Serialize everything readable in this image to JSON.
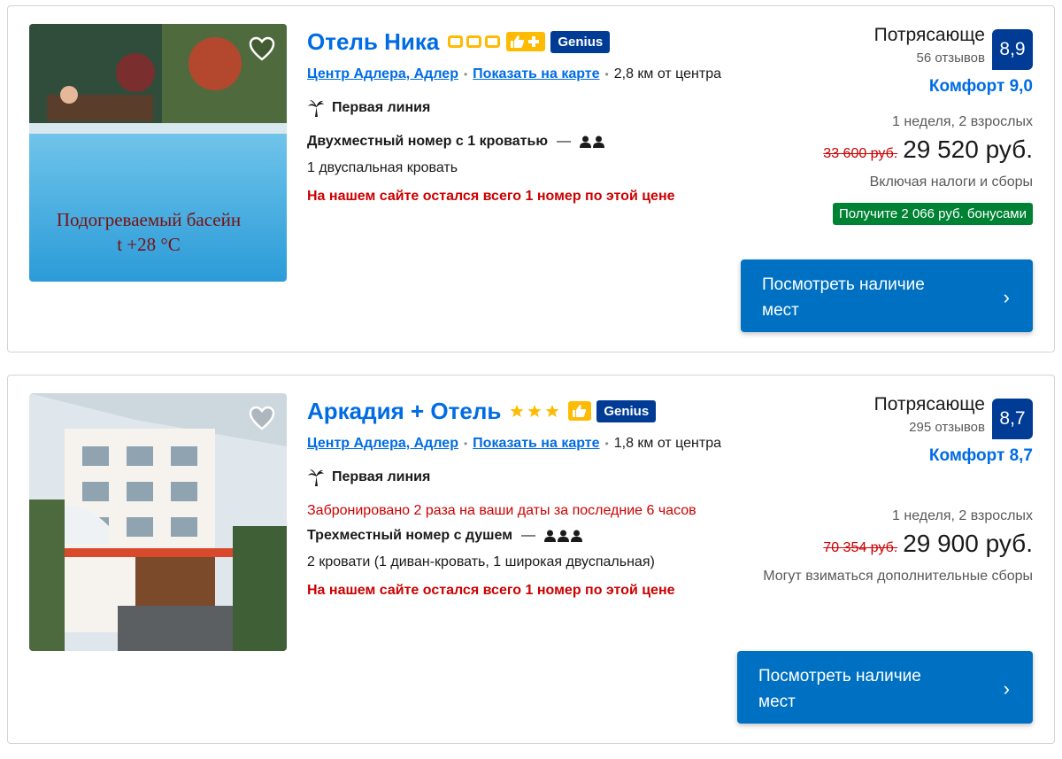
{
  "colors": {
    "link": "#006ce4",
    "score_bg": "#003b95",
    "cta_bg": "#0071c2",
    "bonus_bg": "#008234",
    "alert": "#cc0000",
    "star": "#febb02"
  },
  "hotels": [
    {
      "name": "Отель Ника",
      "rating_icon": "square-rating-icon",
      "rating_count": 3,
      "genius": "Genius",
      "district_link": "Центр Адлера, Адлер",
      "map_link": "Показать на карте",
      "distance": "2,8 км от центра",
      "beach": "Первая линия",
      "booked_notice": "",
      "room": "Двухместный номер с 1 кроватью",
      "dash": "—",
      "guests": 2,
      "beds": "1 двуспальная кровать",
      "scarcity": "На нашем сайте остался всего 1 номер по этой цене",
      "score_word": "Потрясающе",
      "reviews": "56 отзывов",
      "score": "8,9",
      "comfort": "Комфорт 9,0",
      "stay": "1 неделя, 2 взрослых",
      "old_price": "33 600 руб.",
      "price": "29 520 руб.",
      "taxes": "Включая налоги и сборы",
      "bonus": "Получите 2 066 руб. бонусами",
      "cta": "Посмотреть наличие мест",
      "photo_caption_1": "Подогреваемый басейн",
      "photo_caption_2": "t +28 °C"
    },
    {
      "name": "Аркадия + Отель",
      "rating_icon": "star-icon",
      "rating_count": 3,
      "genius": "Genius",
      "district_link": "Центр Адлера, Адлер",
      "map_link": "Показать на карте",
      "distance": "1,8 км от центра",
      "beach": "Первая линия",
      "booked_notice": "Забронировано 2 раза на ваши даты за последние 6 часов",
      "room": "Трехместный номер с душем",
      "dash": "—",
      "guests": 3,
      "beds": "2 кровати (1 диван-кровать, 1 широкая двуспальная)",
      "scarcity": "На нашем сайте остался всего 1 номер по этой цене",
      "score_word": "Потрясающе",
      "reviews": "295 отзывов",
      "score": "8,7",
      "comfort": "Комфорт 8,7",
      "stay": "1 неделя, 2 взрослых",
      "old_price": "70 354 руб.",
      "price": "29 900 руб.",
      "taxes": "Могут взиматься дополнительные сборы",
      "cta": "Посмотреть наличие мест"
    }
  ]
}
